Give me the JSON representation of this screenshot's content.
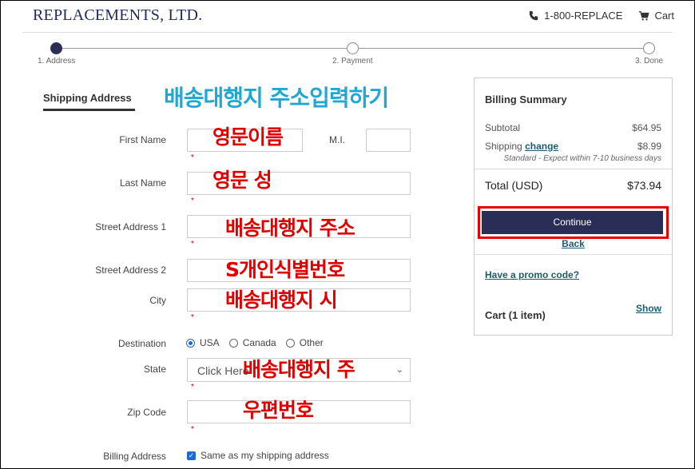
{
  "header": {
    "logo": "REPLACEMENTS, LTD.",
    "phone": "1-800-REPLACE",
    "cart_label": "Cart",
    "phone_icon": "phone-icon",
    "cart_icon": "cart-icon"
  },
  "progress": {
    "steps": [
      "1. Address",
      "2. Payment",
      "3. Done"
    ],
    "current": 1
  },
  "form": {
    "section_title": "Shipping Address",
    "labels": {
      "first_name": "First Name",
      "mi": "M.I.",
      "last_name": "Last Name",
      "street1": "Street Address 1",
      "street2": "Street Address 2",
      "city": "City",
      "destination": "Destination",
      "state": "State",
      "zip": "Zip Code",
      "billing": "Billing Address"
    },
    "required_mark": "*",
    "destination_options": [
      "USA",
      "Canada",
      "Other"
    ],
    "destination_selected": "USA",
    "state_placeholder": "Click Here",
    "billing_same_label": "Same as my shipping address",
    "billing_same_checked": true
  },
  "annotations": {
    "title": "배송대행지 주소입력하기",
    "first_name": "영문이름",
    "last_name": "영문 성",
    "street1": "배송대행지 주소",
    "street2": "S개인식별번호",
    "city": "배송대행지 시",
    "state": "배송대행지 주",
    "zip": "우편번호"
  },
  "billing": {
    "title": "Billing Summary",
    "subtotal_label": "Subtotal",
    "subtotal_value": "$64.95",
    "shipping_label": "Shipping",
    "shipping_link": "change",
    "shipping_value": "$8.99",
    "shipping_note": "Standard - Expect within 7-10 business days",
    "total_label": "Total (USD)",
    "total_value": "$73.94",
    "continue_label": "Continue",
    "back_label": "Back",
    "promo_label": "Have a promo code?",
    "cart_label": "Cart (1 item)",
    "show_label": "Show"
  },
  "colors": {
    "brand": "#2a2d55",
    "link": "#1e5b6b",
    "annotation_red": "#e00000",
    "annotation_blue": "#21a7d3",
    "highlight": "#e60000"
  }
}
